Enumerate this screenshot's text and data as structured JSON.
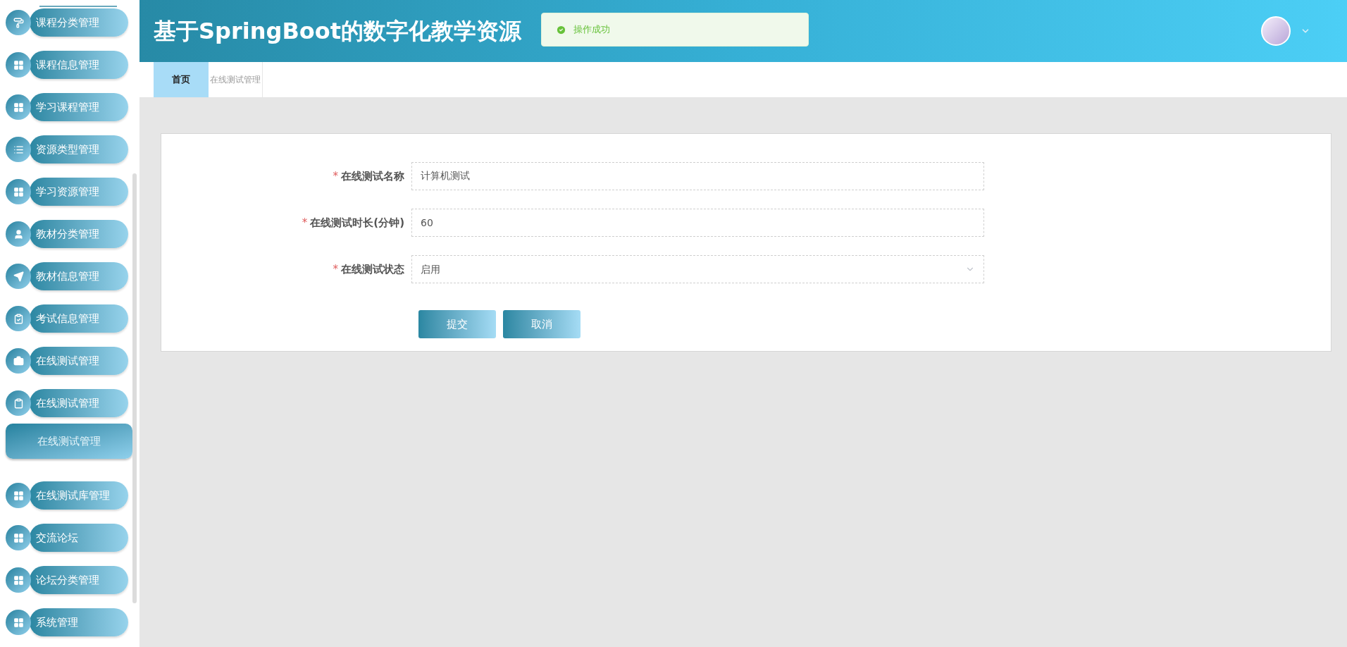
{
  "sidebar": {
    "items": [
      {
        "label": "课程分类管理"
      },
      {
        "label": "课程信息管理"
      },
      {
        "label": "学习课程管理"
      },
      {
        "label": "资源类型管理"
      },
      {
        "label": "学习资源管理"
      },
      {
        "label": "教材分类管理"
      },
      {
        "label": "教材信息管理"
      },
      {
        "label": "考试信息管理"
      },
      {
        "label": "在线测试管理"
      },
      {
        "label": "在线测试管理",
        "children": [
          {
            "label": "在线测试管理"
          }
        ]
      },
      {
        "label": "在线测试库管理"
      },
      {
        "label": "交流论坛"
      },
      {
        "label": "论坛分类管理"
      },
      {
        "label": "系统管理"
      }
    ]
  },
  "header": {
    "title": "基于SpringBoot的数字化教学资源",
    "toast": {
      "message": "操作成功"
    }
  },
  "tabs": [
    {
      "label": "首页",
      "selected": true
    },
    {
      "label": "在线测试管理",
      "selected": false
    }
  ],
  "form": {
    "fields": [
      {
        "kind": "text",
        "mark": "*",
        "label": "在线测试名称",
        "value": "计算机测试"
      },
      {
        "kind": "text",
        "mark": "*",
        "label": "在线测试时长(分钟)",
        "value": "60"
      },
      {
        "kind": "select",
        "mark": "*",
        "label": "在线测试状态",
        "value": "启用"
      }
    ],
    "buttons": [
      {
        "label": "提交"
      },
      {
        "label": "取消"
      }
    ]
  }
}
